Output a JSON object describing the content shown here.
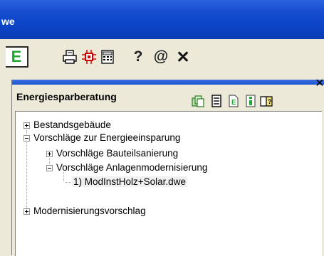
{
  "window": {
    "title": "we"
  },
  "toolbar": {
    "icons": [
      "e-logo-icon",
      "printer-icon",
      "red-component-icon",
      "calculator-icon"
    ],
    "e_label": "E",
    "help_label": "?",
    "at_label": "@",
    "close_label": "✕"
  },
  "panel": {
    "title": "Energiesparberatung",
    "close_label": "✕",
    "header_icons": [
      "copy-icon",
      "document-list-icon",
      "export-document-icon",
      "info-icon",
      "help-book-icon"
    ],
    "tree": [
      {
        "label": "Bestandsgebäude",
        "expander": "+"
      },
      {
        "label": "Vorschläge zur Energieeinsparung",
        "expander": "-"
      },
      {
        "label": "Vorschläge Bauteilsanierung",
        "expander": "+"
      },
      {
        "label": "Vorschläge Anlagenmodernisierung",
        "expander": "-"
      },
      {
        "label": "1) ModInstHolz+Solar.dwe",
        "selected": true
      },
      {
        "label": "Modernisierungsvorschlag",
        "expander": "+"
      }
    ]
  },
  "colors": {
    "titlebar": "#0C45C9",
    "background": "#ECE9D8",
    "e_icon_green": "#21A632"
  }
}
